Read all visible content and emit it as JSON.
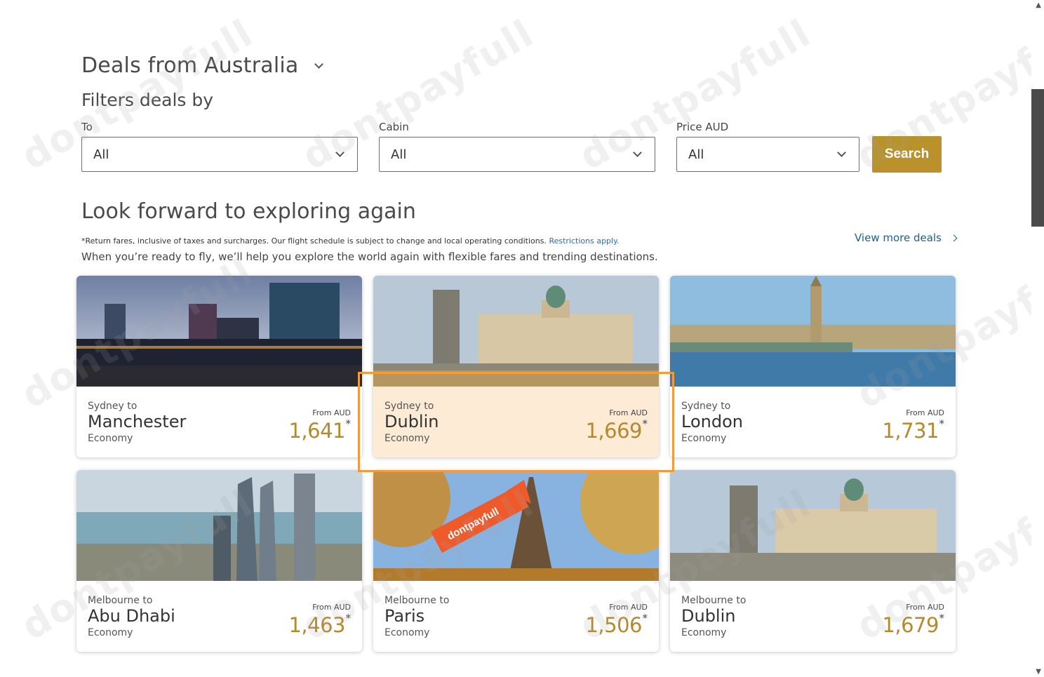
{
  "header": {
    "title": "Deals from Australia",
    "filters_title": "Filters deals by"
  },
  "filters": {
    "to": {
      "label": "To",
      "value": "All"
    },
    "cabin": {
      "label": "Cabin",
      "value": "All"
    },
    "price": {
      "label": "Price AUD",
      "value": "All"
    },
    "search_label": "Search"
  },
  "section": {
    "title": "Look forward to exploring again",
    "disclaimer": "*Return fares, inclusive of taxes and surcharges. Our flight schedule is subject to change and local operating conditions.",
    "restrictions_link": "Restrictions apply.",
    "intro": "When you’re ready to fly, we’ll help you explore the world again with flexible fares and trending destinations.",
    "view_more": "View more deals"
  },
  "deals": [
    {
      "origin": "Sydney to",
      "destination": "Manchester",
      "cabin": "Economy",
      "from_label": "From AUD",
      "price": "1,641",
      "star": "*",
      "image": "manchester-city-skyline"
    },
    {
      "origin": "Sydney to",
      "destination": "Dublin",
      "cabin": "Economy",
      "from_label": "From AUD",
      "price": "1,669",
      "star": "*",
      "image": "dublin-custom-house"
    },
    {
      "origin": "Sydney to",
      "destination": "London",
      "cabin": "Economy",
      "from_label": "From AUD",
      "price": "1,731",
      "star": "*",
      "image": "london-big-ben"
    },
    {
      "origin": "Melbourne to",
      "destination": "Abu Dhabi",
      "cabin": "Economy",
      "from_label": "From AUD",
      "price": "1,463",
      "star": "*",
      "image": "abu-dhabi-towers"
    },
    {
      "origin": "Melbourne to",
      "destination": "Paris",
      "cabin": "Economy",
      "from_label": "From AUD",
      "price": "1,506",
      "star": "*",
      "image": "paris-eiffel-tower"
    },
    {
      "origin": "Melbourne to",
      "destination": "Dublin",
      "cabin": "Economy",
      "from_label": "From AUD",
      "price": "1,679",
      "star": "*",
      "image": "dublin-custom-house"
    }
  ],
  "watermark": "dontpayfull",
  "colors": {
    "accent": "#b9922b",
    "price": "#b48a2e",
    "link": "#1f5f8c",
    "highlight_box": "#f39a3a",
    "highlight_fill": "#fdebd6"
  }
}
